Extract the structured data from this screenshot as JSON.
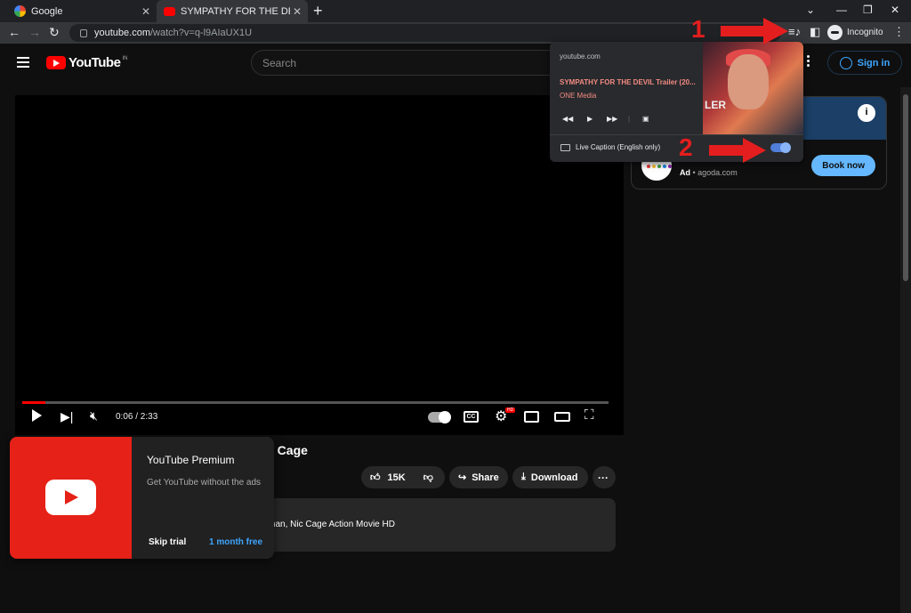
{
  "browser": {
    "tabs": [
      {
        "title": "Google",
        "active": false
      },
      {
        "title": "SYMPATHY FOR THE DEVIL Trailer",
        "active": true
      }
    ],
    "url_host": "youtube.com",
    "url_path": "/watch?v=q-l9AIaUX1U",
    "profile_label": "Incognito"
  },
  "youtube": {
    "logo_text": "YouTube",
    "country_code": "IN",
    "search_placeholder": "Search",
    "signin_label": "Sign in",
    "player": {
      "time": "0:06 / 2:33",
      "progress": 0.04,
      "hd_badge": "HD"
    },
    "video_title_partial": "s Cage",
    "actions": {
      "likes": "15K",
      "share": "Share",
      "download": "Download"
    },
    "description_partial": "naman, Nic Cage Action Movie HD"
  },
  "ad": {
    "label": "Ad",
    "domain": "agoda.com",
    "button": "Book now",
    "info_icon": "i"
  },
  "media_popup": {
    "domain": "youtube.com",
    "title": "SYMPATHY FOR THE DEVIL Trailer (20...",
    "artist": "ONE Media",
    "art_text": "LER",
    "live_caption_label": "Live Caption (English only)",
    "live_caption_on": true
  },
  "premium": {
    "title": "YouTube Premium",
    "subtitle": "Get YouTube without the ads",
    "skip_label": "Skip trial",
    "offer_label": "1 month free"
  },
  "annotations": {
    "step1": "1",
    "step2": "2",
    "color": "#e41e1e"
  }
}
